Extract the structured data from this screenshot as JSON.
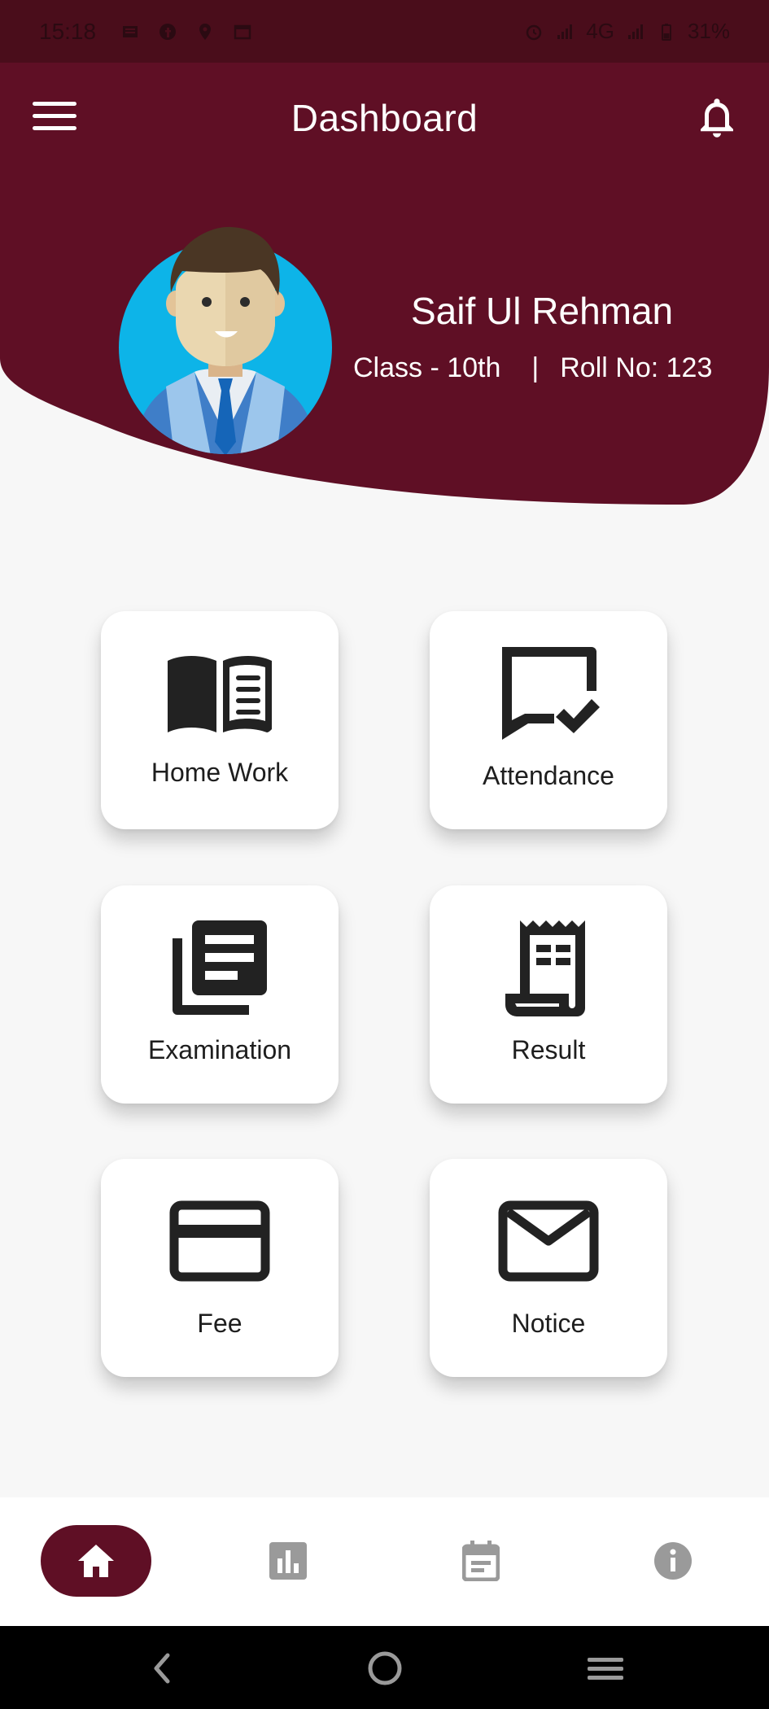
{
  "status_bar": {
    "time": "15:18",
    "network": "4G",
    "battery": "31%"
  },
  "app_bar": {
    "title": "Dashboard"
  },
  "student": {
    "name": "Saif Ul Rehman",
    "class": "Class - 10th",
    "separator": "|",
    "roll": "Roll No: 123"
  },
  "cards": [
    {
      "label": "Home Work",
      "icon": "open-book-icon"
    },
    {
      "label": "Attendance",
      "icon": "chat-check-icon"
    },
    {
      "label": "Examination",
      "icon": "library-books-icon"
    },
    {
      "label": "Result",
      "icon": "receipt-icon"
    },
    {
      "label": "Fee",
      "icon": "credit-card-icon"
    },
    {
      "label": "Notice",
      "icon": "mail-icon"
    }
  ],
  "bottom_nav": {
    "items": [
      "home-icon",
      "bar-chart-icon",
      "calendar-icon",
      "info-icon"
    ],
    "active_color": "#5f0f25"
  },
  "colors": {
    "primary": "#5f0f25",
    "status_bar": "#4a0d1b",
    "background": "#f7f7f7"
  }
}
